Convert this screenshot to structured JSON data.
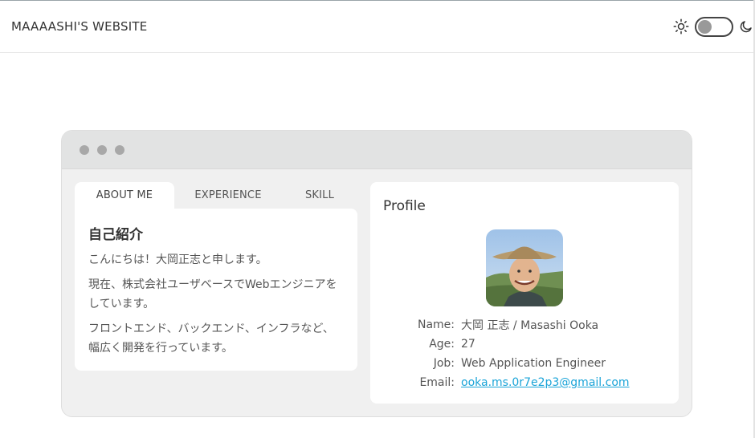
{
  "header": {
    "site_title": "MAAAASHI'S WEBSITE",
    "theme_toggle": {
      "state": "light",
      "icons": [
        "sun-icon",
        "moon-icon"
      ]
    }
  },
  "window": {
    "tabs": [
      {
        "label": "ABOUT ME",
        "active": true
      },
      {
        "label": "EXPERIENCE",
        "active": false
      },
      {
        "label": "SKILL",
        "active": false
      }
    ],
    "about": {
      "heading": "自己紹介",
      "paragraphs": [
        "こんにちは！大岡正志と申します。",
        "現在、株式会社ユーザベースでWebエンジニアをしています。",
        "フロントエンド、バックエンド、インフラなど、幅広く開発を行っています。"
      ]
    },
    "profile": {
      "title": "Profile",
      "rows": [
        {
          "label": "Name:",
          "value": "大岡 正志 / Masashi Ooka"
        },
        {
          "label": "Age:",
          "value": "27"
        },
        {
          "label": "Job:",
          "value": "Web Application Engineer"
        },
        {
          "label": "Email:",
          "value": "ooka.ms.0r7e2p3@gmail.com"
        }
      ]
    }
  },
  "colors": {
    "link": "#1aa4d8",
    "window_bg": "#f0f0f0",
    "titlebar_bg": "#e2e3e3"
  }
}
